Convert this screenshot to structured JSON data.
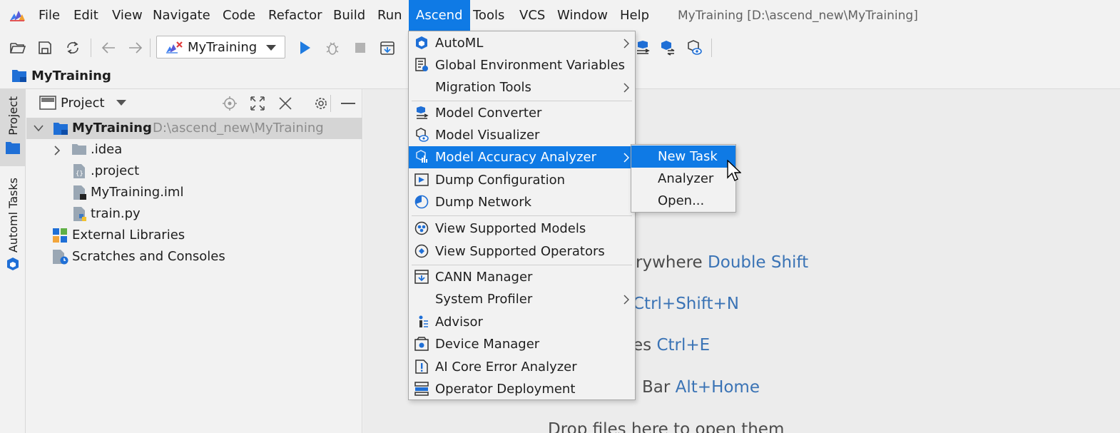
{
  "menubar": {
    "items": [
      {
        "label": "File"
      },
      {
        "label": "Edit"
      },
      {
        "label": "View"
      },
      {
        "label": "Navigate"
      },
      {
        "label": "Code"
      },
      {
        "label": "Refactor"
      },
      {
        "label": "Build"
      },
      {
        "label": "Run"
      },
      {
        "label": "Ascend",
        "active": true
      },
      {
        "label": "Tools"
      },
      {
        "label": "VCS"
      },
      {
        "label": "Window"
      },
      {
        "label": "Help"
      }
    ],
    "window_title": "MyTraining [D:\\ascend_new\\MyTraining]"
  },
  "toolbar": {
    "run_config": "MyTraining",
    "icons": [
      "open-folder-icon",
      "save-icon",
      "sync-icon",
      "back-arrow-icon",
      "forward-arrow-icon",
      "run-icon",
      "debug-icon",
      "stop-icon",
      "deploy-icon"
    ]
  },
  "navbar": {
    "project_name": "MyTraining"
  },
  "tool_strip": {
    "project_tab": "Project",
    "automl_tab": "Automl Tasks"
  },
  "project_panel": {
    "title": "Project",
    "tree": [
      {
        "label": "MyTraining",
        "path": "D:\\ascend_new\\MyTraining",
        "type": "module",
        "expanded": true,
        "selected": true
      },
      {
        "label": ".idea",
        "type": "folder"
      },
      {
        "label": ".project",
        "type": "file"
      },
      {
        "label": "MyTraining.iml",
        "type": "iml"
      },
      {
        "label": "train.py",
        "type": "python"
      },
      {
        "label": "External Libraries",
        "type": "libraries"
      },
      {
        "label": "Scratches and Consoles",
        "type": "scratches"
      }
    ]
  },
  "editor": {
    "hints": [
      {
        "text": "rywhere",
        "shortcut": "Double Shift"
      },
      {
        "text": "",
        "shortcut": "Ctrl+Shift+N"
      },
      {
        "text": "es",
        "shortcut": "Ctrl+E"
      },
      {
        "text": "Bar",
        "shortcut": "Alt+Home"
      },
      {
        "text": "Drop files here to open them",
        "shortcut": ""
      }
    ]
  },
  "ascend_menu": {
    "items": [
      {
        "label": "AutoML",
        "icon": "automl-icon",
        "submenu": true
      },
      {
        "label": "Global Environment Variables",
        "icon": "environment-variables-icon"
      },
      {
        "label": "Migration Tools",
        "icon": "",
        "submenu": true
      },
      {
        "label": "Model Converter",
        "icon": "model-converter-icon"
      },
      {
        "label": "Model Visualizer",
        "icon": "model-visualizer-icon"
      },
      {
        "label": "Model Accuracy Analyzer",
        "icon": "accuracy-analyzer-icon",
        "submenu": true,
        "highlighted": true
      },
      {
        "label": "Dump Configuration",
        "icon": "dump-configuration-icon"
      },
      {
        "label": "Dump Network",
        "icon": "dump-network-icon"
      },
      {
        "label": "View Supported Models",
        "icon": "supported-models-icon"
      },
      {
        "label": "View Supported Operators",
        "icon": "supported-operators-icon"
      },
      {
        "label": "CANN Manager",
        "icon": "cann-manager-icon"
      },
      {
        "label": "System Profiler",
        "icon": "",
        "submenu": true
      },
      {
        "label": "Advisor",
        "icon": "advisor-icon"
      },
      {
        "label": "Device Manager",
        "icon": "device-manager-icon"
      },
      {
        "label": "AI Core Error Analyzer",
        "icon": "error-analyzer-icon"
      },
      {
        "label": "Operator Deployment",
        "icon": "operator-deployment-icon"
      }
    ]
  },
  "submenu": {
    "items": [
      {
        "label": "New Task",
        "highlighted": true
      },
      {
        "label": "Analyzer"
      },
      {
        "label": "Open..."
      }
    ]
  },
  "colors": {
    "accent": "#0f7ae5",
    "shortcut": "#3a73b5",
    "background": "#f2f2f2"
  }
}
